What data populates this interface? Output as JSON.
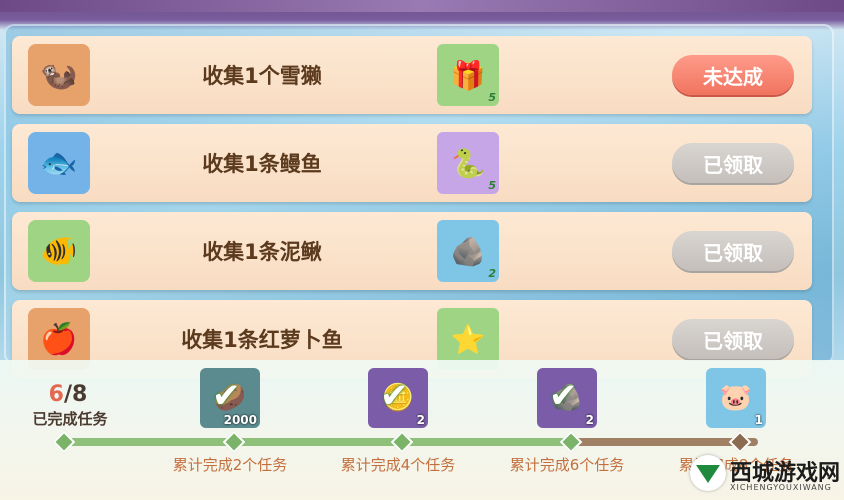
{
  "tasks": [
    {
      "label": "收集1个雪獭",
      "item_icon": "snow-otter-icon",
      "item_glyph": "🦦",
      "item_bg": "#e6a26a",
      "reward_icon": "gift-box-icon",
      "reward_glyph": "🎁",
      "reward_bg": "#9fd485",
      "reward_count": "5",
      "status": "未达成",
      "status_type": "unfinished"
    },
    {
      "label": "收集1条鳗鱼",
      "item_icon": "eel-icon",
      "item_glyph": "🐟",
      "item_bg": "#73b3e8",
      "reward_icon": "snake-icon",
      "reward_glyph": "🐍",
      "reward_bg": "#c6a6e6",
      "reward_count": "5",
      "status": "已领取",
      "status_type": "claimed"
    },
    {
      "label": "收集1条泥鳅",
      "item_icon": "loach-icon",
      "item_glyph": "🐠",
      "item_bg": "#9fd485",
      "reward_icon": "pillow-icon",
      "reward_glyph": "🪨",
      "reward_bg": "#7fc6e6",
      "reward_count": "2",
      "status": "已领取",
      "status_type": "claimed"
    },
    {
      "label": "收集1条红萝卜鱼",
      "item_icon": "carrot-fish-icon",
      "item_glyph": "🍎",
      "item_bg": "#e6a26a",
      "reward_icon": "star-badge-icon",
      "reward_glyph": "⭐",
      "reward_bg": "#9fd485",
      "reward_count": "",
      "status": "已领取",
      "status_type": "claimed"
    }
  ],
  "progress": {
    "done": "6",
    "total": "/8",
    "label": "已完成任务"
  },
  "milestones": [
    {
      "label": "累计完成2个任务",
      "icon": "coin-bag-icon",
      "glyph": "🥔",
      "bg": "#5b8a8f",
      "count": "2000",
      "claimed": true
    },
    {
      "label": "累计完成4个任务",
      "icon": "coin-icon",
      "glyph": "🪙",
      "bg": "#7a5ca8",
      "count": "2",
      "claimed": true
    },
    {
      "label": "累计完成6个任务",
      "icon": "cushion-icon",
      "glyph": "🪨",
      "bg": "#7a5ca8",
      "count": "2",
      "claimed": true
    },
    {
      "label": "累计完成8个任务",
      "icon": "pig-outfit-icon",
      "glyph": "🐷",
      "bg": "#7fc6e6",
      "count": "1",
      "claimed": false
    }
  ],
  "watermark": {
    "title": "西城游戏网",
    "subtitle": "XICHENGYOUXIWANG"
  },
  "colors": {
    "unfinished": "#f0745f",
    "claimed": "#c4bfbb",
    "progress_fill": "#8ec07a",
    "progress_track": "#a08064"
  }
}
